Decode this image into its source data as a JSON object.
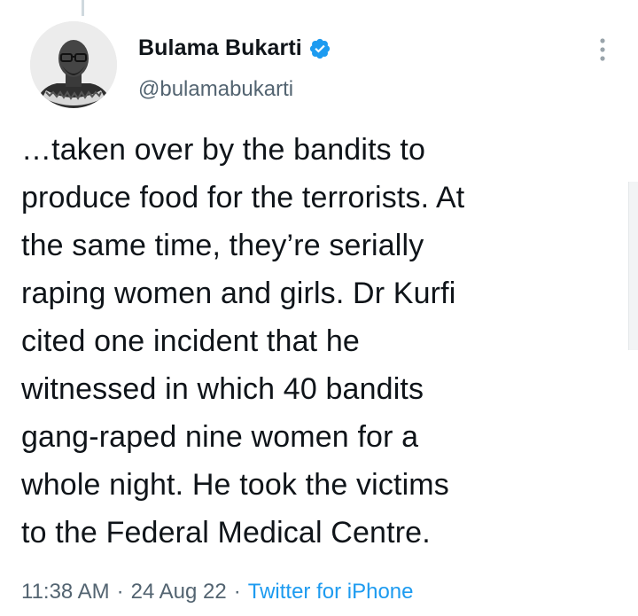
{
  "tweet": {
    "author": {
      "display_name": "Bulama Bukarti",
      "handle": "@bulamabukarti",
      "verified": true
    },
    "text": "…taken over by the bandits to\nproduce food for the terrorists. At\nthe same time, they’re serially\nraping women and girls. Dr Kurfi\ncited one incident that he\nwitnessed in which 40 bandits\ngang-raped nine women for a\nwhole night. He took the victims\nto the Federal Medical Centre.",
    "time": "11:38 AM",
    "separator": "·",
    "date": "24 Aug 22",
    "source": "Twitter for iPhone"
  },
  "icons": {
    "verified": "verified-badge-icon",
    "more": "more-options-icon"
  },
  "colors": {
    "verified_blue": "#1d9bf0",
    "link_blue": "#1d9bf0",
    "secondary_text": "#536471",
    "primary_text": "#0f1419"
  }
}
